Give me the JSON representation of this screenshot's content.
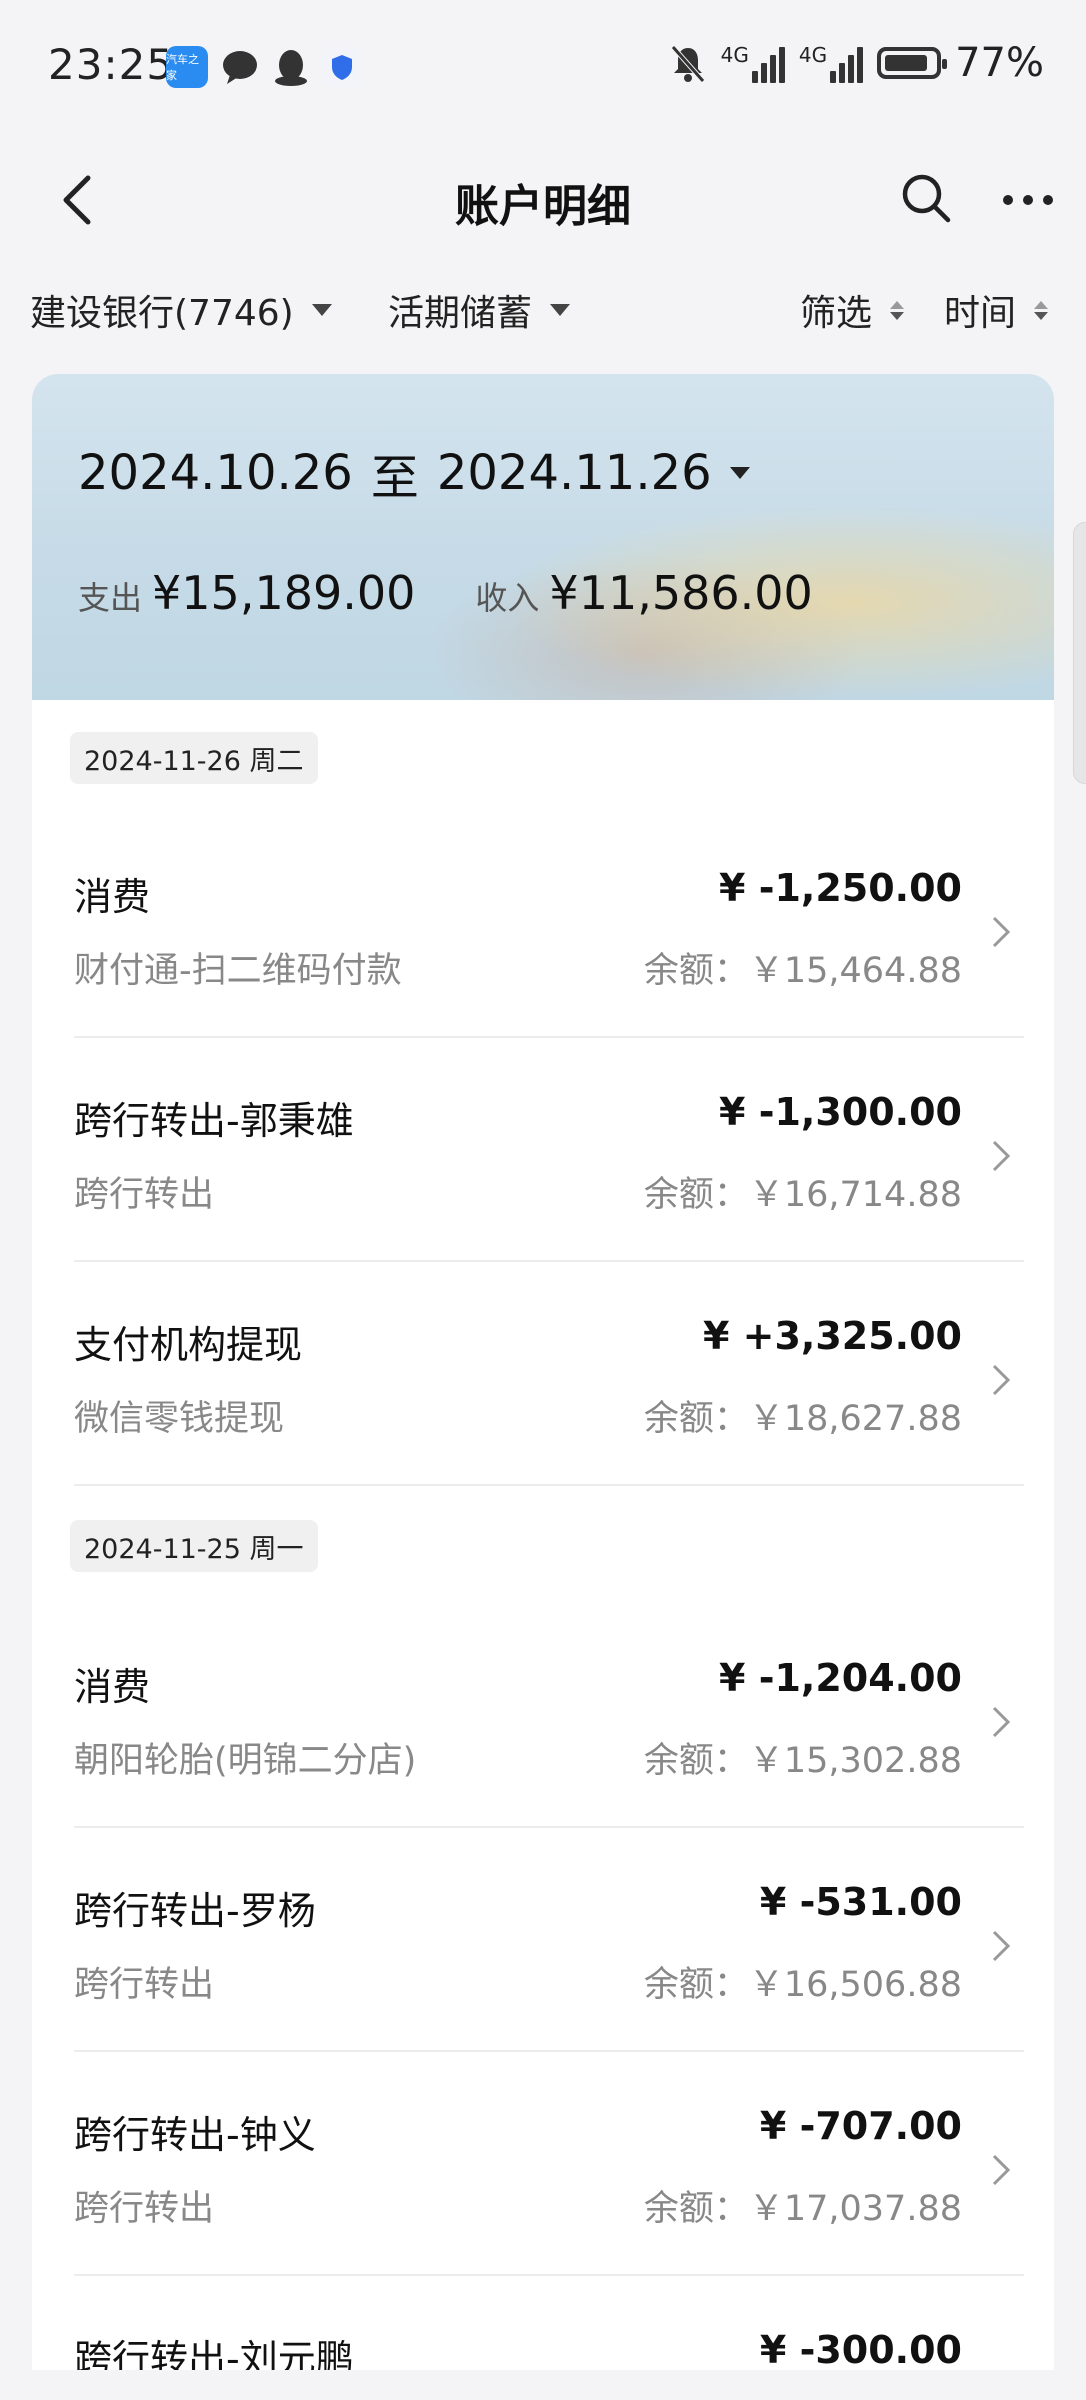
{
  "status": {
    "time": "23:25",
    "net1": "4G",
    "net2": "4G",
    "battery": "77%",
    "app1": "汽车之家"
  },
  "nav": {
    "title": "账户明细"
  },
  "filters": {
    "account": "建设银行(7746)",
    "type": "活期储蓄",
    "filter": "筛选",
    "sort": "时间"
  },
  "summary": {
    "date_from": "2024.10.26",
    "date_to_sep": "至",
    "date_to": "2024.11.26",
    "out_label": "支出",
    "out_value": "¥15,189.00",
    "in_label": "收入",
    "in_value": "¥11,586.00"
  },
  "groups": [
    {
      "date": "2024-11-26 周二",
      "items": [
        {
          "title": "消费",
          "sub": "财付通-扫二维码付款",
          "amount": "¥ -1,250.00",
          "balance": "余额：￥15,464.88"
        },
        {
          "title": "跨行转出-郭秉雄",
          "sub": "跨行转出",
          "amount": "¥ -1,300.00",
          "balance": "余额：￥16,714.88"
        },
        {
          "title": "支付机构提现",
          "sub": "微信零钱提现",
          "amount": "¥ +3,325.00",
          "balance": "余额：￥18,627.88"
        }
      ]
    },
    {
      "date": "2024-11-25 周一",
      "items": [
        {
          "title": "消费",
          "sub": "朝阳轮胎(明锦二分店)",
          "amount": "¥ -1,204.00",
          "balance": "余额：￥15,302.88"
        },
        {
          "title": "跨行转出-罗杨",
          "sub": "跨行转出",
          "amount": "¥ -531.00",
          "balance": "余额：￥16,506.88"
        },
        {
          "title": "跨行转出-钟义",
          "sub": "跨行转出",
          "amount": "¥ -707.00",
          "balance": "余额：￥17,037.88"
        },
        {
          "title": "跨行转出-刘元鹏",
          "sub": "",
          "amount": "¥ -300.00",
          "balance": ""
        }
      ]
    }
  ]
}
